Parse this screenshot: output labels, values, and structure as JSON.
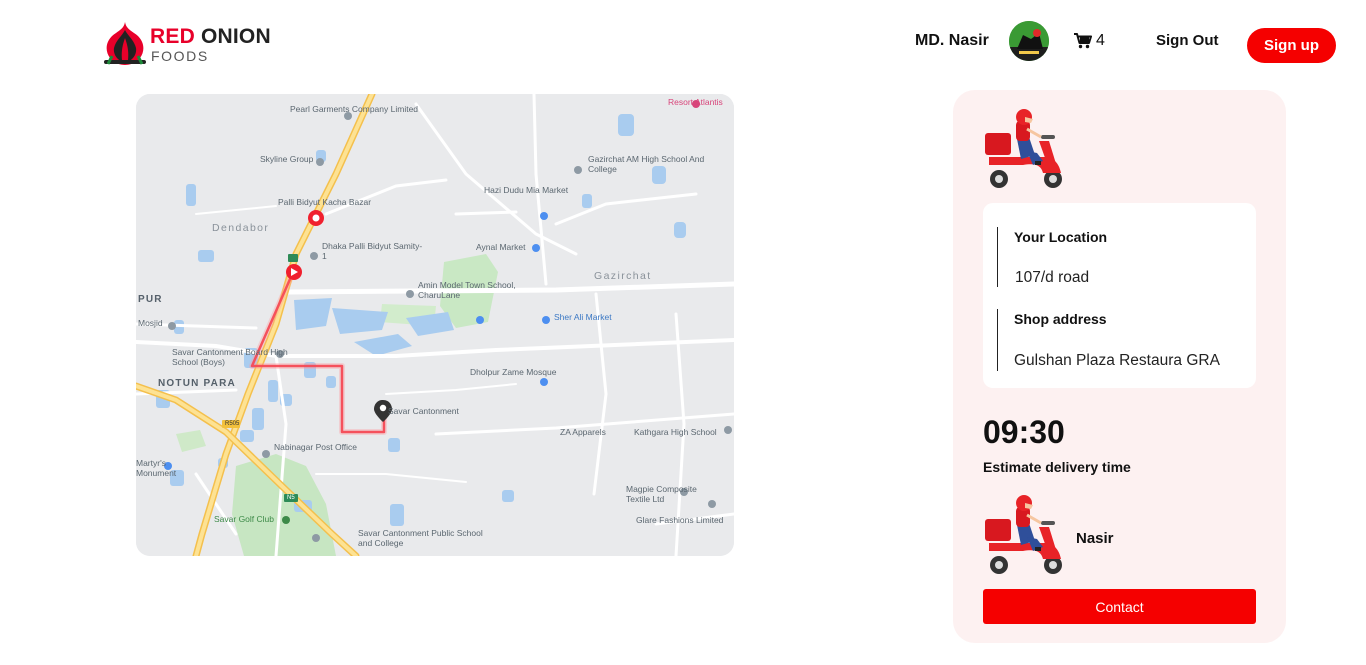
{
  "brand": {
    "name_primary": "RED",
    "name_secondary": "ONION",
    "tagline": "FOODS"
  },
  "header": {
    "user_name": "MD. Nasir",
    "cart_count": "4",
    "sign_out_label": "Sign Out",
    "sign_up_label": "Sign up"
  },
  "map": {
    "places": [
      "Pearl Garments Company Limited",
      "Skyline Group",
      "Palli Bidyut Kacha Bazar",
      "Dendabor",
      "Dhaka Palli Bidyut Samity-1",
      "Gazirchat AM High School And College",
      "Hazi Dudu Mia Market",
      "Aynal Market",
      "Gazirchat",
      "Amin Model Town School, CharuLane",
      "Sher Ali Market",
      "Mosjid",
      "Savar Cantonment Board High School (Boys)",
      "NOTUN PARA",
      "Dholpur Zame Mosque",
      "Savar Cantonment",
      "ZA Apparels",
      "Kathgara High School",
      "Nabinagar Post Office",
      "Magpie Composite Textile Ltd",
      "Glare Fashions Limited",
      "Savar Golf Club",
      "Savar Cantonment Public School and College",
      "Resort Atlantis",
      "Martyr's Monument",
      "PUR",
      "R505",
      "N5"
    ]
  },
  "delivery": {
    "your_location_label": "Your Location",
    "your_location_value": "107/d road",
    "shop_address_label": "Shop address",
    "shop_address_value": "Gulshan Plaza Restaura GRA",
    "time": "09:30",
    "time_label": "Estimate delivery time",
    "rider_name": "Nasir",
    "contact_label": "Contact"
  },
  "colors": {
    "accent": "#f50000",
    "panel_bg": "#fdf1f1",
    "route": "#f0202e"
  },
  "icons": [
    "onion-logo-icon",
    "cart-icon",
    "scooter-icon",
    "map-pin-icon"
  ]
}
